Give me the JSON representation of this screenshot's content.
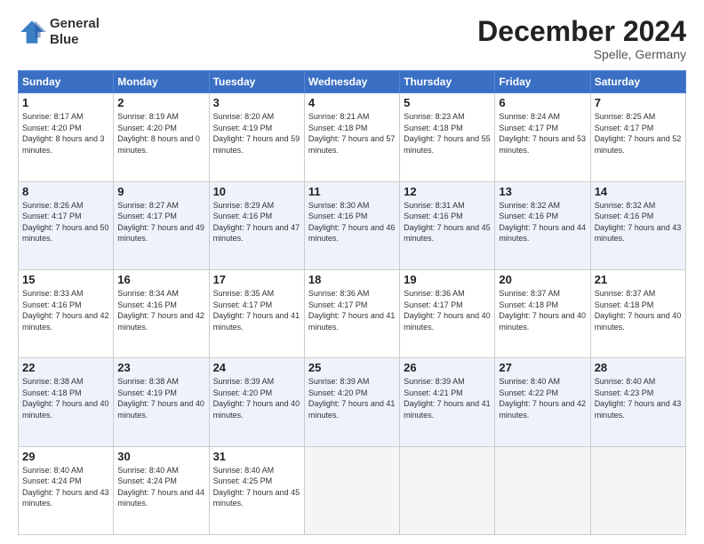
{
  "logo": {
    "line1": "General",
    "line2": "Blue"
  },
  "title": "December 2024",
  "location": "Spelle, Germany",
  "days_header": [
    "Sunday",
    "Monday",
    "Tuesday",
    "Wednesday",
    "Thursday",
    "Friday",
    "Saturday"
  ],
  "weeks": [
    [
      {
        "num": "1",
        "sunrise": "8:17 AM",
        "sunset": "4:20 PM",
        "daylight": "8 hours and 3 minutes."
      },
      {
        "num": "2",
        "sunrise": "8:19 AM",
        "sunset": "4:20 PM",
        "daylight": "8 hours and 0 minutes."
      },
      {
        "num": "3",
        "sunrise": "8:20 AM",
        "sunset": "4:19 PM",
        "daylight": "7 hours and 59 minutes."
      },
      {
        "num": "4",
        "sunrise": "8:21 AM",
        "sunset": "4:18 PM",
        "daylight": "7 hours and 57 minutes."
      },
      {
        "num": "5",
        "sunrise": "8:23 AM",
        "sunset": "4:18 PM",
        "daylight": "7 hours and 55 minutes."
      },
      {
        "num": "6",
        "sunrise": "8:24 AM",
        "sunset": "4:17 PM",
        "daylight": "7 hours and 53 minutes."
      },
      {
        "num": "7",
        "sunrise": "8:25 AM",
        "sunset": "4:17 PM",
        "daylight": "7 hours and 52 minutes."
      }
    ],
    [
      {
        "num": "8",
        "sunrise": "8:26 AM",
        "sunset": "4:17 PM",
        "daylight": "7 hours and 50 minutes."
      },
      {
        "num": "9",
        "sunrise": "8:27 AM",
        "sunset": "4:17 PM",
        "daylight": "7 hours and 49 minutes."
      },
      {
        "num": "10",
        "sunrise": "8:29 AM",
        "sunset": "4:16 PM",
        "daylight": "7 hours and 47 minutes."
      },
      {
        "num": "11",
        "sunrise": "8:30 AM",
        "sunset": "4:16 PM",
        "daylight": "7 hours and 46 minutes."
      },
      {
        "num": "12",
        "sunrise": "8:31 AM",
        "sunset": "4:16 PM",
        "daylight": "7 hours and 45 minutes."
      },
      {
        "num": "13",
        "sunrise": "8:32 AM",
        "sunset": "4:16 PM",
        "daylight": "7 hours and 44 minutes."
      },
      {
        "num": "14",
        "sunrise": "8:32 AM",
        "sunset": "4:16 PM",
        "daylight": "7 hours and 43 minutes."
      }
    ],
    [
      {
        "num": "15",
        "sunrise": "8:33 AM",
        "sunset": "4:16 PM",
        "daylight": "7 hours and 42 minutes."
      },
      {
        "num": "16",
        "sunrise": "8:34 AM",
        "sunset": "4:16 PM",
        "daylight": "7 hours and 42 minutes."
      },
      {
        "num": "17",
        "sunrise": "8:35 AM",
        "sunset": "4:17 PM",
        "daylight": "7 hours and 41 minutes."
      },
      {
        "num": "18",
        "sunrise": "8:36 AM",
        "sunset": "4:17 PM",
        "daylight": "7 hours and 41 minutes."
      },
      {
        "num": "19",
        "sunrise": "8:36 AM",
        "sunset": "4:17 PM",
        "daylight": "7 hours and 40 minutes."
      },
      {
        "num": "20",
        "sunrise": "8:37 AM",
        "sunset": "4:18 PM",
        "daylight": "7 hours and 40 minutes."
      },
      {
        "num": "21",
        "sunrise": "8:37 AM",
        "sunset": "4:18 PM",
        "daylight": "7 hours and 40 minutes."
      }
    ],
    [
      {
        "num": "22",
        "sunrise": "8:38 AM",
        "sunset": "4:18 PM",
        "daylight": "7 hours and 40 minutes."
      },
      {
        "num": "23",
        "sunrise": "8:38 AM",
        "sunset": "4:19 PM",
        "daylight": "7 hours and 40 minutes."
      },
      {
        "num": "24",
        "sunrise": "8:39 AM",
        "sunset": "4:20 PM",
        "daylight": "7 hours and 40 minutes."
      },
      {
        "num": "25",
        "sunrise": "8:39 AM",
        "sunset": "4:20 PM",
        "daylight": "7 hours and 41 minutes."
      },
      {
        "num": "26",
        "sunrise": "8:39 AM",
        "sunset": "4:21 PM",
        "daylight": "7 hours and 41 minutes."
      },
      {
        "num": "27",
        "sunrise": "8:40 AM",
        "sunset": "4:22 PM",
        "daylight": "7 hours and 42 minutes."
      },
      {
        "num": "28",
        "sunrise": "8:40 AM",
        "sunset": "4:23 PM",
        "daylight": "7 hours and 43 minutes."
      }
    ],
    [
      {
        "num": "29",
        "sunrise": "8:40 AM",
        "sunset": "4:24 PM",
        "daylight": "7 hours and 43 minutes."
      },
      {
        "num": "30",
        "sunrise": "8:40 AM",
        "sunset": "4:24 PM",
        "daylight": "7 hours and 44 minutes."
      },
      {
        "num": "31",
        "sunrise": "8:40 AM",
        "sunset": "4:25 PM",
        "daylight": "7 hours and 45 minutes."
      },
      null,
      null,
      null,
      null
    ]
  ]
}
